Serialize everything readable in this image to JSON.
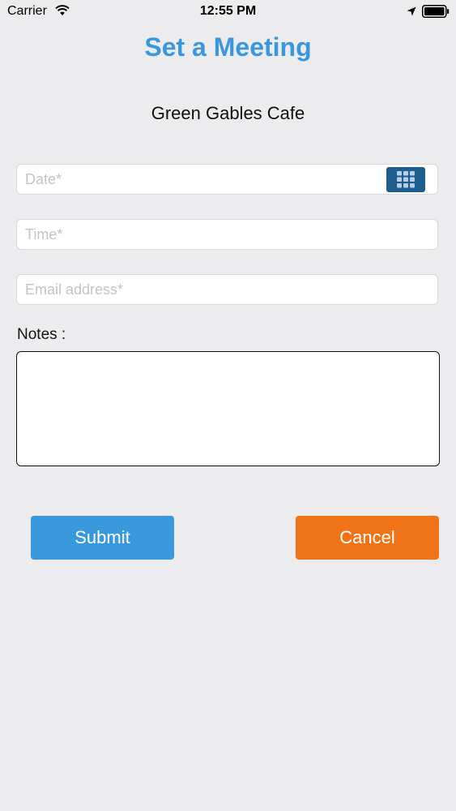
{
  "status_bar": {
    "carrier": "Carrier",
    "time": "12:55 PM"
  },
  "header": {
    "title": "Set a Meeting",
    "title_color": "#3a96dd"
  },
  "venue": {
    "name": "Green Gables Cafe"
  },
  "form": {
    "date": {
      "placeholder": "Date*",
      "value": ""
    },
    "time": {
      "placeholder": "Time*",
      "value": ""
    },
    "email": {
      "placeholder": "Email address*",
      "value": ""
    },
    "notes": {
      "label": "Notes :",
      "value": ""
    }
  },
  "actions": {
    "submit_label": "Submit",
    "submit_color": "#3a98dd",
    "cancel_label": "Cancel",
    "cancel_color": "#f07417"
  },
  "icons": {
    "wifi": "wifi-icon",
    "location": "location-arrow-icon",
    "battery": "battery-icon",
    "calendar": "calendar-grid-icon"
  }
}
